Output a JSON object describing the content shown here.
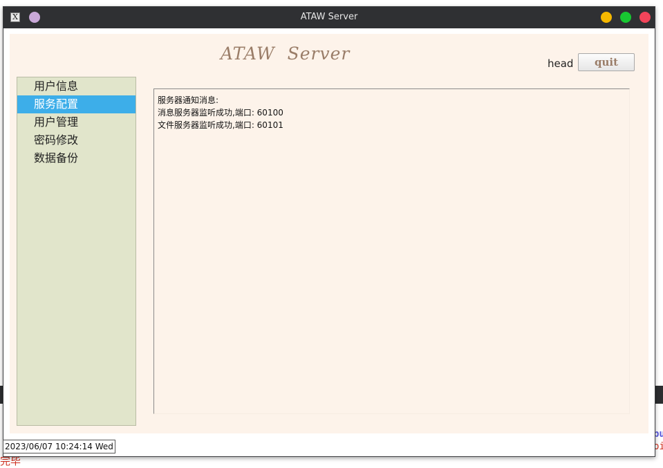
{
  "window": {
    "title": "ATAW Server"
  },
  "header": {
    "app_title": "ATAW  Server",
    "user_label": "head",
    "quit_label": "quit"
  },
  "sidebar": {
    "items": [
      {
        "label": "用户信息",
        "active": false
      },
      {
        "label": "服务配置",
        "active": true
      },
      {
        "label": "用户管理",
        "active": false
      },
      {
        "label": "密码修改",
        "active": false
      },
      {
        "label": "数据备份",
        "active": false
      }
    ]
  },
  "log": {
    "lines": [
      "服务器通知消息:",
      "消息服务器监听成功,端口: 60100",
      "文件服务器监听成功,端口: 60101"
    ]
  },
  "status": {
    "timestamp": "2023/06/07 10:24:14 Wed"
  },
  "background": {
    "left_text": "完毕",
    "right_text_1": "bu",
    "right_text_2": "pi"
  },
  "colors": {
    "client_bg": "#fdf3ea",
    "sidebar_bg": "#e1e5cb",
    "selection": "#3daee9",
    "title_accent": "#9a7d68",
    "titlebar_bg": "#2f3033",
    "btn_minimize": "#f6b800",
    "btn_maximize": "#18c832",
    "btn_close": "#f2445a"
  },
  "icons": {
    "app": "x-app-icon",
    "pin": "pin-dot-icon"
  }
}
